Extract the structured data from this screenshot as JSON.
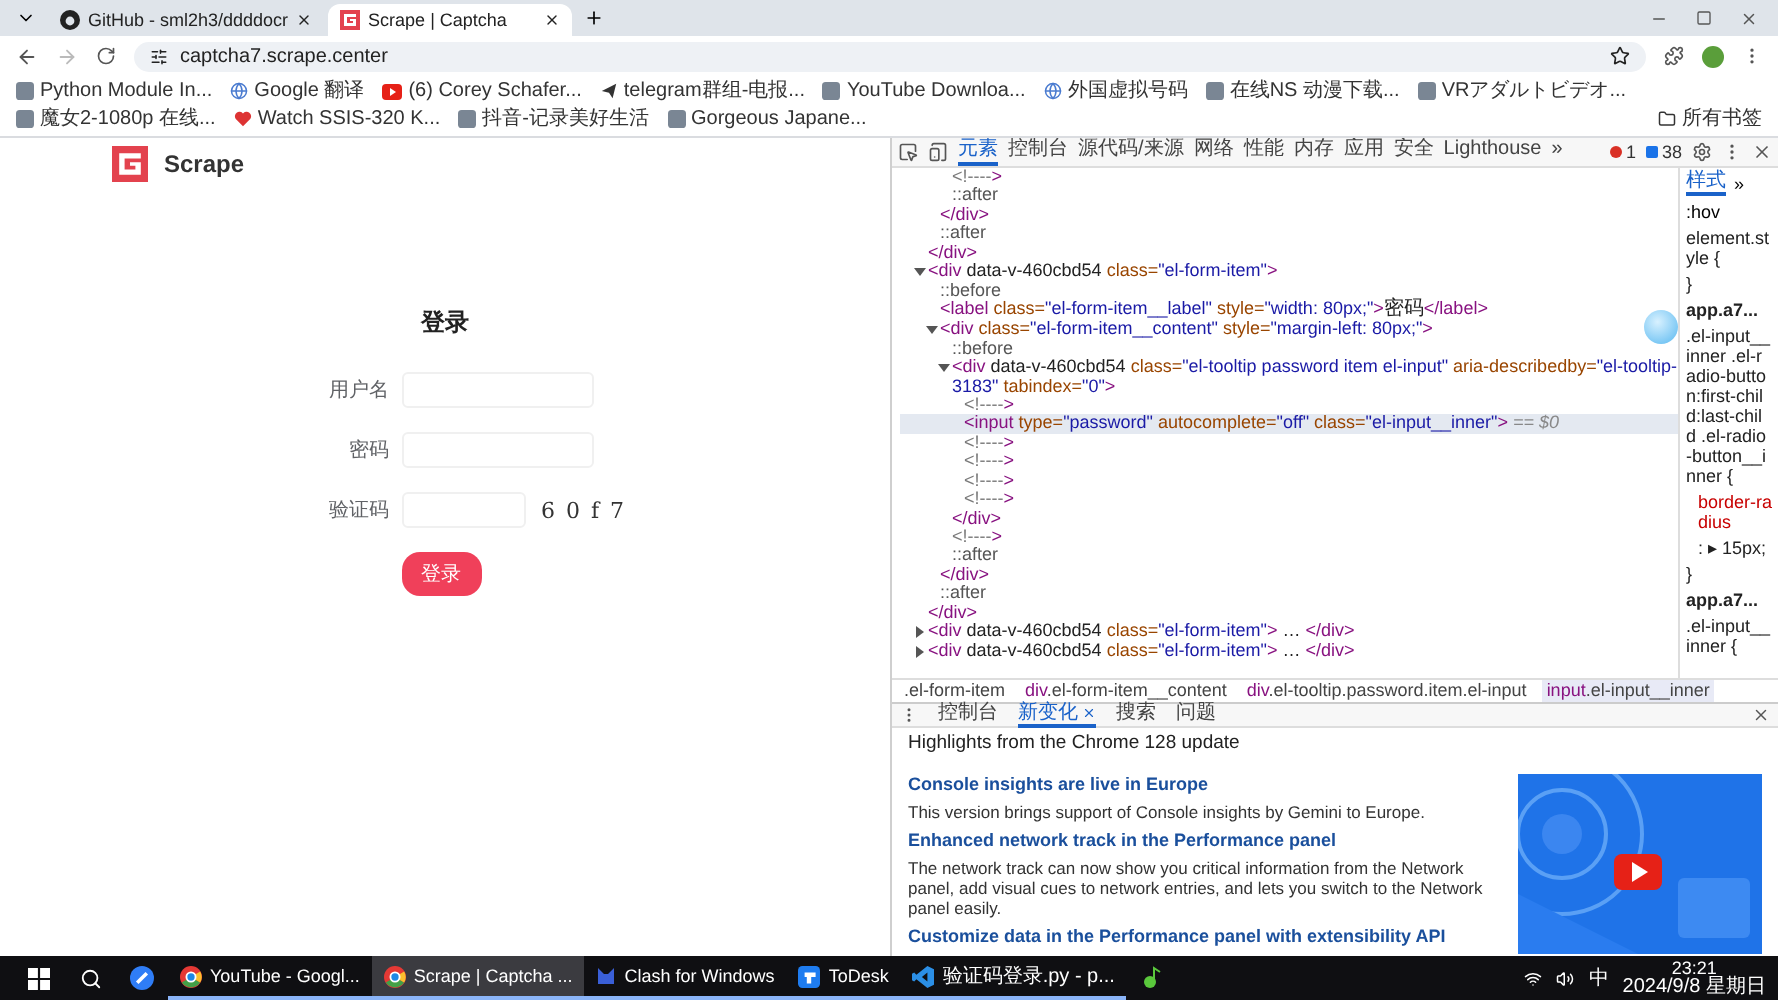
{
  "browser": {
    "tabs": [
      {
        "title": "GitHub - sml2h3/ddddocr",
        "selected": false
      },
      {
        "title": "Scrape | Captcha",
        "selected": true
      }
    ],
    "address": "captcha7.scrape.center",
    "bookmarks": [
      {
        "label": "Python Module In..."
      },
      {
        "label": "Google 翻译"
      },
      {
        "label": "(6) Corey Schafer..."
      },
      {
        "label": "telegram群组-电报..."
      },
      {
        "label": "YouTube Downloa..."
      },
      {
        "label": "外国虚拟号码"
      },
      {
        "label": "在线NS 动漫下载..."
      },
      {
        "label": "VRアダルトビデオ..."
      },
      {
        "label": "魔女2-1080p 在线..."
      },
      {
        "label": "Watch SSIS-320 K..."
      },
      {
        "label": "抖音-记录美好生活"
      },
      {
        "label": "Gorgeous Japane..."
      }
    ],
    "all_bookmarks": "所有书签"
  },
  "page": {
    "logo": "Scrape",
    "title": "登录",
    "fields": [
      {
        "label": "用户名",
        "kind": "text"
      },
      {
        "label": "密码",
        "kind": "text"
      },
      {
        "label": "验证码",
        "kind": "captcha",
        "captcha": "6 0 f 7"
      }
    ],
    "submit": "登录"
  },
  "devtools": {
    "tabs": [
      {
        "label": "元素",
        "selected": true
      },
      {
        "label": "控制台",
        "selected": false
      },
      {
        "label": "源代码/来源",
        "selected": false
      },
      {
        "label": "网络",
        "selected": false
      },
      {
        "label": "性能",
        "selected": false
      },
      {
        "label": "内存",
        "selected": false
      },
      {
        "label": "应用",
        "selected": false
      },
      {
        "label": "安全",
        "selected": false
      },
      {
        "label": "Lighthouse",
        "selected": false
      }
    ],
    "more": "»",
    "errors": "1",
    "messages": "38",
    "dom": [
      {
        "children": [
          {
            "children": [
              {
                "text": "<!---->"
              },
              {
                "text": "::after"
              }
            ],
            "close": "</div>"
          },
          {
            "text": "::after"
          }
        ],
        "close": "</div>"
      },
      {
        "open": "<div data-v-460cbd54 class=\"el-form-item\">",
        "expanded": true,
        "close": "</div>",
        "children": [
          {
            "text": "::before"
          },
          {
            "text": "<label class=\"el-form-item__label\" style=\"width: 80px;\">密码</label>"
          },
          {
            "open": "<div class=\"el-form-item__content\" style=\"margin-left: 80px;\">",
            "expanded": true,
            "close": "</div>",
            "children": [
              {
                "text": "::before"
              },
              {
                "open": "<div data-v-460cbd54 class=\"el-tooltip password item el-input\" aria-describedby=\"el-tooltip-3183\" tabindex=\"0\">",
                "expanded": true,
                "close": "</div>",
                "children": [
                  {
                    "text": "<!---->"
                  },
                  {
                    "text": "<input type=\"password\" autocomplete=\"off\" class=\"el-input__inner\">",
                    "selected": true,
                    "note": "== $0"
                  },
                  {
                    "text": "<!---->"
                  },
                  {
                    "text": "<!---->"
                  },
                  {
                    "text": "<!---->"
                  },
                  {
                    "text": "<!---->"
                  }
                ]
              },
              {
                "text": "<!---->"
              },
              {
                "text": "::after"
              }
            ]
          },
          {
            "text": "::after"
          }
        ]
      },
      {
        "open": "<div data-v-460cbd54 class=\"el-form-item\"> … </div>",
        "expanded": false
      },
      {
        "open": "<div data-v-460cbd54 class=\"el-form-item\"> … </div>",
        "expanded": false
      }
    ],
    "styles": {
      "tab": "样式",
      "more": "»",
      "filter": ":hov",
      "lines": [
        {
          "kind": "selector",
          "text": "element.style {"
        },
        {
          "kind": "brace",
          "text": "}"
        },
        {
          "kind": "source",
          "text": "app.a7..."
        },
        {
          "kind": "selector",
          "text": ".el-input__inner .el-radio-button:first-child:last-child .el-radio-button__inner {"
        },
        {
          "kind": "property",
          "text": "border-radius"
        },
        {
          "kind": "value",
          "text": ": ▸ 15px;"
        },
        {
          "kind": "brace",
          "text": "}"
        },
        {
          "kind": "source",
          "text": "app.a7..."
        },
        {
          "kind": "selector",
          "text": ".el-input__inner {"
        }
      ]
    },
    "breadcrumbs": [
      {
        "label": ".el-form-item",
        "selected": false
      },
      {
        "label": "div.el-form-item__content",
        "selected": false
      },
      {
        "label": "div.el-tooltip.password.item.el-input",
        "selected": false
      },
      {
        "label": "input.el-input__inner",
        "selected": true
      }
    ],
    "drawer": {
      "tabs": [
        {
          "label": "控制台",
          "selected": false,
          "closable": false
        },
        {
          "label": "新变化",
          "selected": true,
          "closable": true
        },
        {
          "label": "搜索",
          "selected": false,
          "closable": false
        },
        {
          "label": "问题",
          "selected": false,
          "closable": false
        }
      ],
      "heading": "Highlights from the Chrome 128 update",
      "items": [
        {
          "kind": "title",
          "text": "Console insights are live in Europe"
        },
        {
          "kind": "text",
          "text": "This version brings support of Console insights by Gemini to Europe."
        },
        {
          "kind": "title",
          "text": "Enhanced network track in the Performance panel"
        },
        {
          "kind": "text",
          "text": "The network track can now show you critical information from the Network panel, add visual cues to network entries, and lets you switch to the Network panel easily."
        },
        {
          "kind": "title",
          "text": "Customize data in the Performance panel with extensibility API"
        }
      ]
    }
  },
  "taskbar": {
    "apps": [
      {
        "label": "YouTube - Googl...",
        "selected": false
      },
      {
        "label": "Scrape | Captcha ...",
        "selected": true
      },
      {
        "label": "Clash for Windows",
        "selected": false
      },
      {
        "label": "ToDesk",
        "selected": false
      },
      {
        "label": "验证码登录.py - p...",
        "selected": false
      }
    ],
    "ime": "中",
    "time": "23:21",
    "date": "2024/9/8 星期日"
  }
}
